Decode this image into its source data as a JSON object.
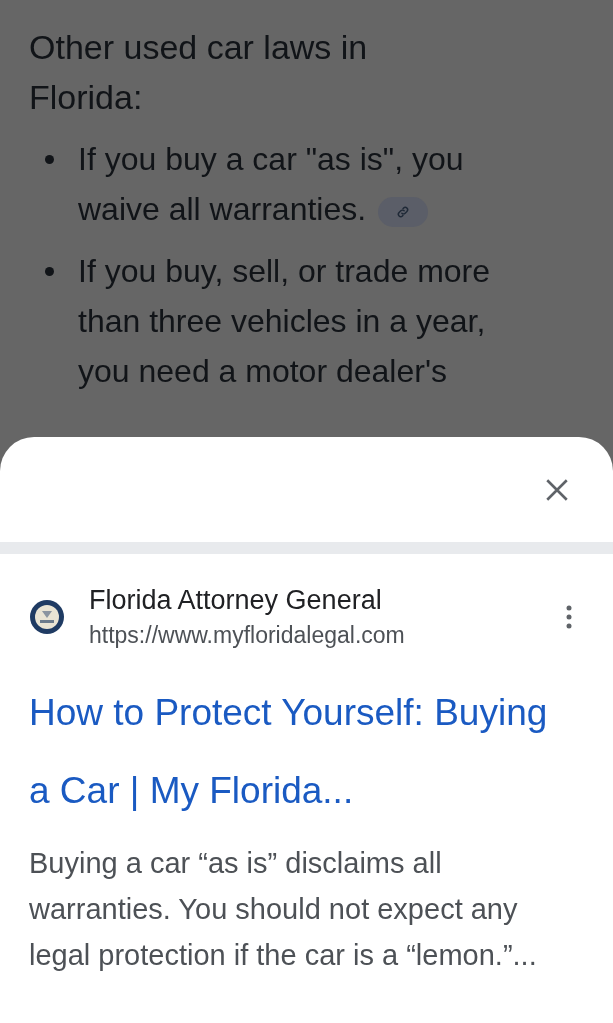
{
  "article": {
    "heading": "Other used car laws in Florida:",
    "bullets": [
      {
        "text": "If you buy a car \"as is\", you waive all warranties.",
        "has_link": true
      },
      {
        "text": "If you buy, sell, or trade more than three vehicles in a year, you need a motor dealer's",
        "has_link": false
      }
    ]
  },
  "sheet": {
    "source": {
      "name": "Florida Attorney General",
      "url": "https://www.myfloridalegal.com"
    },
    "title": "How to Protect Yourself: Buying a Car | My Florida...",
    "snippet": "Buying a car “as is” disclaims all warranties. You should not expect any legal protection if the car is a “lemon.”..."
  }
}
